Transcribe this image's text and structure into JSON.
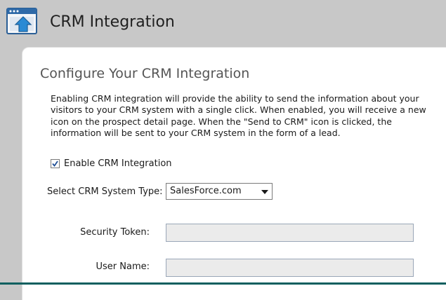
{
  "header": {
    "title": "CRM Integration",
    "icon": "window-upload-icon"
  },
  "panel": {
    "heading": "Configure Your CRM Integration",
    "description": "Enabling CRM integration will provide the ability to send the information about your visitors to your CRM system with a single click.  When enabled, you will receive a new icon on the prospect detail page.  When the \"Send to CRM\" icon is clicked, the information will be sent to your CRM system in the form of a lead."
  },
  "form": {
    "enable_crm": {
      "label": "Enable CRM Integration",
      "checked": true
    },
    "crm_type": {
      "label": "Select CRM System Type:",
      "value": "SalesForce.com"
    },
    "security_token": {
      "label": "Security Token:",
      "value": ""
    },
    "user_name": {
      "label": "User Name:",
      "value": ""
    }
  },
  "colors": {
    "header_bg": "#c8c8c8",
    "panel_bg": "#ffffff",
    "input_bg": "#ebebeb",
    "accent": "#2a8ad4"
  }
}
